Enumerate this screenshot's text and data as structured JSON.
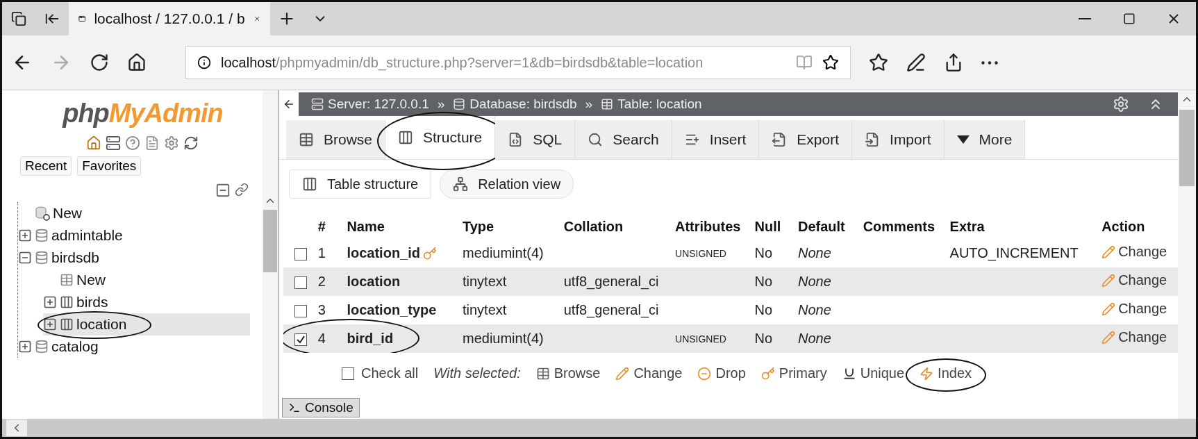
{
  "browser": {
    "tab_title": "localhost / 127.0.0.1 / b",
    "address_host": "localhost",
    "address_path": "/phpmyadmin/db_structure.php?server=1&db=birdsdb&table=location"
  },
  "sidebar": {
    "logo_php": "php",
    "logo_myadmin": "MyAdmin",
    "tabs": [
      {
        "label": "Recent",
        "selected": false
      },
      {
        "label": "Favorites",
        "selected": false
      }
    ],
    "tree": [
      {
        "label": "New",
        "kind": "new",
        "selected": false
      },
      {
        "label": "admintable",
        "kind": "database",
        "expanded": false,
        "selected": false
      },
      {
        "label": "birdsdb",
        "kind": "database",
        "expanded": true,
        "selected": false,
        "children": [
          {
            "label": "New",
            "kind": "new-table",
            "selected": false
          },
          {
            "label": "birds",
            "kind": "table",
            "expanded": false,
            "selected": false
          },
          {
            "label": "location",
            "kind": "table",
            "expanded": false,
            "selected": true,
            "circled": true
          }
        ]
      },
      {
        "label": "catalog",
        "kind": "database",
        "expanded": false,
        "selected": false
      }
    ]
  },
  "breadcrumb": {
    "separator": "»",
    "items": [
      {
        "label": "Server: 127.0.0.1",
        "kind": "server"
      },
      {
        "label": "Database: birdsdb",
        "kind": "database"
      },
      {
        "label": "Table: location",
        "kind": "table"
      }
    ]
  },
  "tabs": [
    {
      "label": "Browse",
      "kind": "browse",
      "selected": false
    },
    {
      "label": "Structure",
      "kind": "structure",
      "selected": true,
      "circled": true
    },
    {
      "label": "SQL",
      "kind": "sql",
      "selected": false
    },
    {
      "label": "Search",
      "kind": "search",
      "selected": false
    },
    {
      "label": "Insert",
      "kind": "insert",
      "selected": false
    },
    {
      "label": "Export",
      "kind": "export",
      "selected": false
    },
    {
      "label": "Import",
      "kind": "import",
      "selected": false
    },
    {
      "label": "More",
      "kind": "more",
      "selected": false
    }
  ],
  "subtabs": [
    {
      "label": "Table structure",
      "kind": "structure",
      "selected": true
    },
    {
      "label": "Relation view",
      "kind": "relation",
      "selected": false
    }
  ],
  "table": {
    "columns": [
      "#",
      "Name",
      "Type",
      "Collation",
      "Attributes",
      "Null",
      "Default",
      "Comments",
      "Extra",
      "Action"
    ],
    "rows": [
      {
        "checked": false,
        "num": "1",
        "name": "location_id",
        "primary": true,
        "type": "mediumint(4)",
        "attributes": "UNSIGNED",
        "null": "No",
        "default": "None",
        "extra": "AUTO_INCREMENT",
        "action": "Change"
      },
      {
        "checked": false,
        "num": "2",
        "name": "location",
        "primary": false,
        "type": "tinytext",
        "collation": "utf8_general_ci",
        "null": "No",
        "default": "None",
        "action": "Change"
      },
      {
        "checked": false,
        "num": "3",
        "name": "location_type",
        "primary": false,
        "type": "tinytext",
        "collation": "utf8_general_ci",
        "null": "No",
        "default": "None",
        "action": "Change"
      },
      {
        "checked": true,
        "num": "4",
        "name": "bird_id",
        "primary": false,
        "type": "mediumint(4)",
        "attributes": "UNSIGNED",
        "null": "No",
        "default": "None",
        "action": "Change",
        "circled": true
      }
    ]
  },
  "footer": {
    "check_all": "Check all",
    "checked": false,
    "with_selected": "With selected:",
    "actions": [
      {
        "label": "Browse",
        "kind": "browse"
      },
      {
        "label": "Change",
        "kind": "change"
      },
      {
        "label": "Drop",
        "kind": "drop"
      },
      {
        "label": "Primary",
        "kind": "primary"
      },
      {
        "label": "Unique",
        "kind": "unique"
      },
      {
        "label": "Index",
        "kind": "index",
        "circled": true
      }
    ]
  },
  "console": "Console"
}
